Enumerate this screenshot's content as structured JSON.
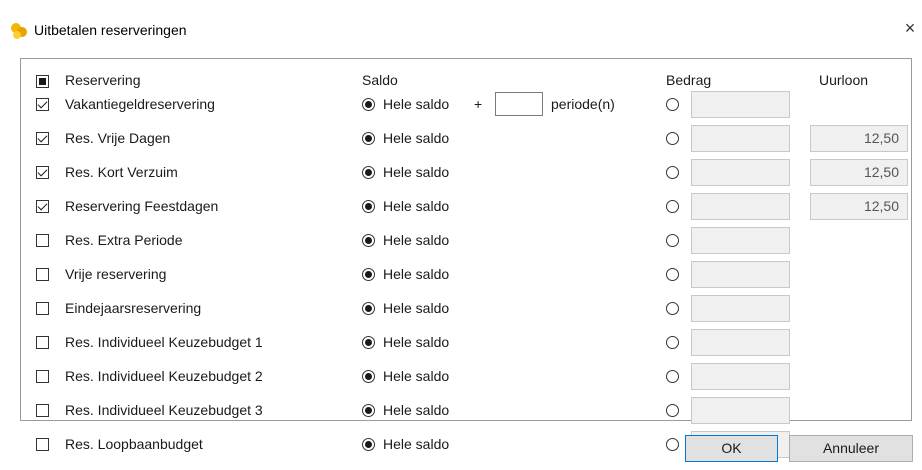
{
  "window": {
    "title": "Uitbetalen reserveringen",
    "close_glyph": "×"
  },
  "headers": {
    "reservering": "Reservering",
    "saldo": "Saldo",
    "bedrag": "Bedrag",
    "uurloon": "Uurloon"
  },
  "saldo_option": "Hele saldo",
  "period_plus": "+",
  "period_label": "periode(n)",
  "rows": [
    {
      "label": "Vakantiegeldreservering",
      "checked": true,
      "wage": ""
    },
    {
      "label": "Res. Vrije Dagen",
      "checked": true,
      "wage": "12,50"
    },
    {
      "label": "Res. Kort Verzuim",
      "checked": true,
      "wage": "12,50"
    },
    {
      "label": "Reservering Feestdagen",
      "checked": true,
      "wage": "12,50"
    },
    {
      "label": "Res. Extra Periode",
      "checked": false,
      "wage": ""
    },
    {
      "label": "Vrije reservering",
      "checked": false,
      "wage": ""
    },
    {
      "label": "Eindejaarsreservering",
      "checked": false,
      "wage": ""
    },
    {
      "label": "Res. Individueel Keuzebudget 1",
      "checked": false,
      "wage": ""
    },
    {
      "label": "Res. Individueel Keuzebudget 2",
      "checked": false,
      "wage": ""
    },
    {
      "label": "Res. Individueel Keuzebudget 3",
      "checked": false,
      "wage": ""
    },
    {
      "label": "Res. Loopbaanbudget",
      "checked": false,
      "wage": ""
    }
  ],
  "buttons": {
    "ok": "OK",
    "cancel": "Annuleer"
  },
  "icons": {
    "app": "coins-icon",
    "close": "close-icon"
  }
}
